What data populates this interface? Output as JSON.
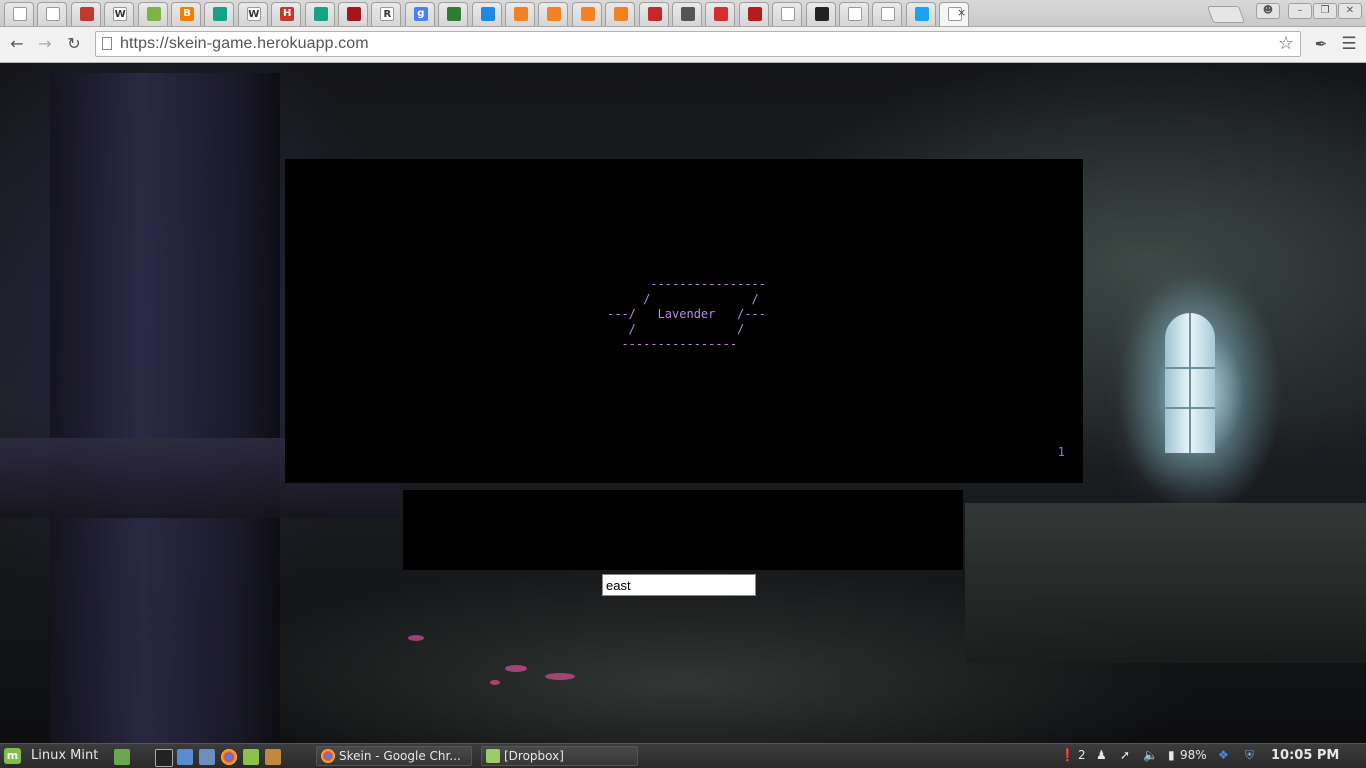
{
  "browser": {
    "tabs": [
      {
        "icon": "page-icon",
        "color": "#ffffff"
      },
      {
        "icon": "page-icon",
        "color": "#ffffff"
      },
      {
        "icon": "pixel-character-icon",
        "color": "#c0392b"
      },
      {
        "icon": "wikipedia-icon",
        "color": "#ffffff",
        "glyph": "W"
      },
      {
        "icon": "leaf-icon",
        "color": "#7cb342"
      },
      {
        "icon": "blogger-icon",
        "color": "#f57d00",
        "glyph": "B"
      },
      {
        "icon": "teal-square-icon",
        "color": "#16a085"
      },
      {
        "icon": "wikipedia-icon",
        "color": "#ffffff",
        "glyph": "W"
      },
      {
        "icon": "hacker-icon",
        "color": "#c0392b",
        "glyph": "H"
      },
      {
        "icon": "teal-square-icon",
        "color": "#16a085"
      },
      {
        "icon": "shield-icon",
        "color": "#a4161a"
      },
      {
        "icon": "r-letter-icon",
        "color": "#ffffff",
        "glyph": "R"
      },
      {
        "icon": "google-icon",
        "color": "#4a80f5",
        "glyph": "g"
      },
      {
        "icon": "diamond-icon",
        "color": "#2e7d32"
      },
      {
        "icon": "tool-icon",
        "color": "#1e88e5"
      },
      {
        "icon": "stackoverflow-icon",
        "color": "#f48024"
      },
      {
        "icon": "stackexchange-icon",
        "color": "#f48024"
      },
      {
        "icon": "stackexchange-icon",
        "color": "#f48024"
      },
      {
        "icon": "stackexchange-icon",
        "color": "#f48024"
      },
      {
        "icon": "book-icon",
        "color": "#c62828"
      },
      {
        "icon": "audio-icon",
        "color": "#555555"
      },
      {
        "icon": "extension-icon",
        "color": "#d32f2f"
      },
      {
        "icon": "chart-icon",
        "color": "#b71c1c"
      },
      {
        "icon": "page-icon",
        "color": "#ffffff"
      },
      {
        "icon": "chat-icon",
        "color": "#222222"
      },
      {
        "icon": "page-icon",
        "color": "#ffffff"
      },
      {
        "icon": "page-icon",
        "color": "#ffffff"
      },
      {
        "icon": "twitter-icon",
        "color": "#1da1f2"
      },
      {
        "icon": "page-icon",
        "color": "#ffffff",
        "active": true
      }
    ],
    "url": "https://skein-game.herokuapp.com"
  },
  "game": {
    "banner": "      ----------------\n     /              /\n---/   Lavender   /---\n   /              /\n  ----------------",
    "room_number": "1",
    "command_value": "east",
    "colors": {
      "banner": "#b88ae0",
      "room_number": "#8e78e6",
      "panel": "#000000"
    }
  },
  "taskbar": {
    "menu_label": "Linux Mint",
    "tasks": [
      {
        "label": "Skein - Google Chr...",
        "icon": "chrome-icon"
      },
      {
        "label": "[Dropbox]",
        "icon": "folder-icon"
      }
    ],
    "notifications": "2",
    "battery": "98%",
    "clock": "10:05 PM"
  }
}
